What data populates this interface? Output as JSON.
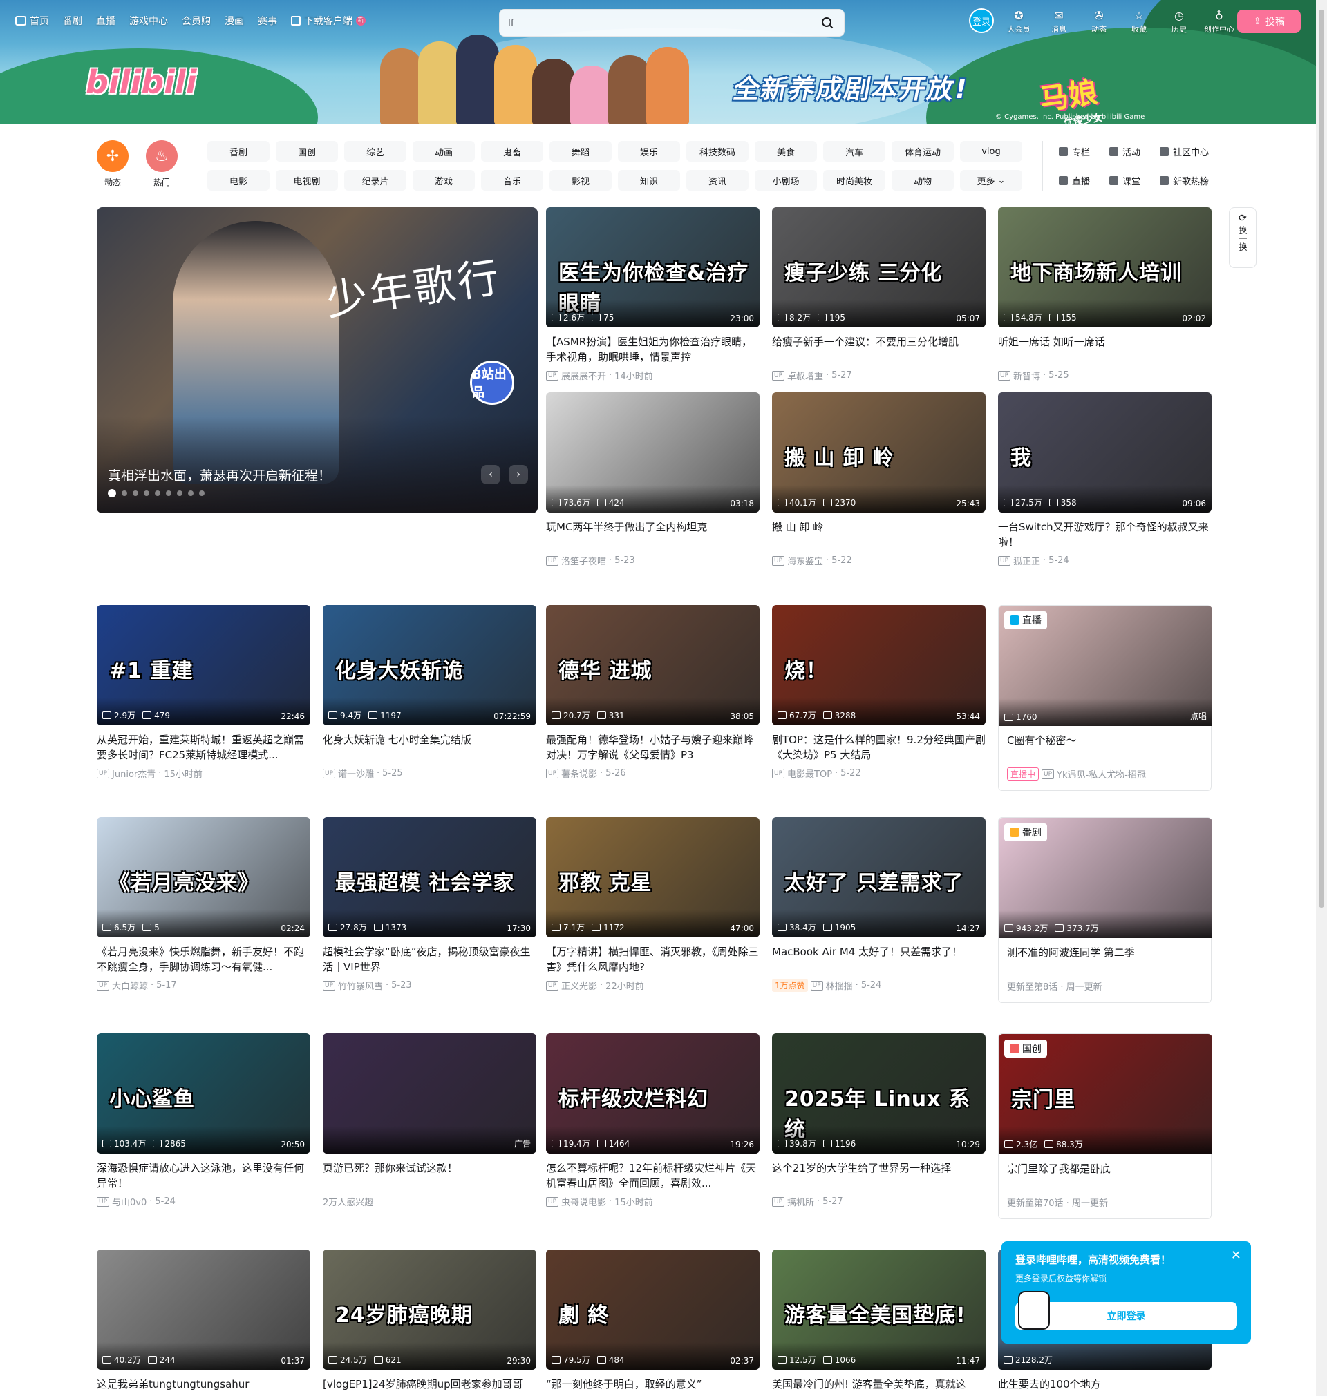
{
  "topnav": {
    "items": [
      {
        "label": "首页",
        "icon": "bilibili-tv-icon"
      },
      {
        "label": "番剧"
      },
      {
        "label": "直播"
      },
      {
        "label": "游戏中心"
      },
      {
        "label": "会员购"
      },
      {
        "label": "漫画"
      },
      {
        "label": "赛事"
      },
      {
        "label": "下载客户端",
        "icon": "download-icon",
        "badge": "新"
      }
    ],
    "search_value": "lf",
    "login_label": "登录",
    "right_items": [
      {
        "label": "大会员",
        "icon": "vip-icon"
      },
      {
        "label": "消息",
        "icon": "message-icon"
      },
      {
        "label": "动态",
        "icon": "dynamic-icon"
      },
      {
        "label": "收藏",
        "icon": "star-icon"
      },
      {
        "label": "历史",
        "icon": "clock-icon"
      },
      {
        "label": "创作中心",
        "icon": "bulb-icon"
      }
    ],
    "upload_label": "投稿"
  },
  "banner": {
    "logo": "bilibili",
    "promo_text": "全新养成剧本开放!",
    "game_logo": "马娘",
    "game_sub": "优俊少女",
    "copyright": "© Cygames, Inc. Published by bilibili Game"
  },
  "channels": {
    "icons": [
      {
        "label": "动态",
        "icon": "pinwheel-icon"
      },
      {
        "label": "热门",
        "icon": "flame-icon"
      }
    ],
    "buttons": [
      "番剧",
      "国创",
      "综艺",
      "动画",
      "鬼畜",
      "舞蹈",
      "娱乐",
      "科技数码",
      "美食",
      "汽车",
      "体育运动",
      "vlog",
      "电影",
      "电视剧",
      "纪录片",
      "游戏",
      "音乐",
      "影视",
      "知识",
      "资讯",
      "小剧场",
      "时尚美妆",
      "动物",
      "更多"
    ],
    "links": [
      "专栏",
      "活动",
      "社区中心",
      "直播",
      "课堂",
      "新歌热榜"
    ]
  },
  "carousel": {
    "title": "真相浮出水面，萧瑟再次开启新征程！",
    "calligraphy": "少年歌行",
    "badge": "B站出品",
    "dot_count": 9,
    "active_dot": 0
  },
  "refresh_label": "换一换",
  "cards": [
    {
      "views": "2.6万",
      "comments": "75",
      "duration": "23:00",
      "title": "【ASMR扮演】医生姐姐为你检查治疗眼睛，手术视角，助眠哄睡，情景声控",
      "up": "展展展不开",
      "date": "14小时前",
      "caption": "医生为你检查&治疗眼睛",
      "color": "#3d5a6b"
    },
    {
      "views": "8.2万",
      "comments": "195",
      "duration": "05:07",
      "title": "给瘦子新手一个建议：不要用三分化增肌",
      "up": "卓叔增重",
      "date": "5-27",
      "caption": "瘦子少练 三分化",
      "color": "#5a5a5c"
    },
    {
      "views": "54.8万",
      "comments": "155",
      "duration": "02:02",
      "title": "听姐一席话 如听一席话",
      "up": "新智博",
      "date": "5-25",
      "caption": "地下商场新人培训",
      "color": "#6a7a5a"
    },
    {
      "views": "73.6万",
      "comments": "424",
      "duration": "03:18",
      "title": "玩MC两年半终于做出了全内构坦克",
      "up": "洛笙子夜喵",
      "date": "5-23",
      "caption": "",
      "color": "#d8d8d8"
    },
    {
      "views": "40.1万",
      "comments": "2370",
      "duration": "25:43",
      "title": "搬 山 卸 岭",
      "up": "海东鉴宝",
      "date": "5-22",
      "caption": "搬 山 卸 岭",
      "color": "#8a6a4a"
    },
    {
      "views": "27.5万",
      "comments": "358",
      "duration": "09:06",
      "title": "一台Switch又开游戏厅？那个奇怪的叔叔又来啦！",
      "up": "狐正正",
      "date": "5-24",
      "caption": "我",
      "color": "#4a4a5a"
    },
    {
      "views": "2.9万",
      "comments": "479",
      "duration": "22:46",
      "title": "从英冠开始，重建莱斯特城！重返英超之巅需要多长时间？FC25莱斯特城经理模式...",
      "up": "Junior杰青",
      "date": "15小时前",
      "caption": "#1 重建",
      "color": "#1d3f8a"
    },
    {
      "views": "9.4万",
      "comments": "1197",
      "duration": "07:22:59",
      "title": "化身大妖斩诡 七小时全集完结版",
      "up": "诺一沙雕",
      "date": "5-25",
      "caption": "化身大妖斩诡",
      "color": "#2a5a8a"
    },
    {
      "views": "20.7万",
      "comments": "331",
      "duration": "38:05",
      "title": "最强配角！德华登场！小姑子与嫂子迎来巅峰对决！万字解说《父母爱情》P3",
      "up": "薯条说影",
      "date": "5-26",
      "caption": "德华 进城",
      "color": "#6a4a3a"
    },
    {
      "views": "67.7万",
      "comments": "3288",
      "duration": "53:44",
      "title": "剧TOP：这是什么样的国家！9.2分经典国产剧《大染坊》P5 大结局",
      "up": "电影最TOP",
      "date": "5-22",
      "caption": "烧！",
      "color": "#7a2a1a"
    },
    {
      "views": "1760",
      "comments": "",
      "duration": "点唱",
      "title": "C圈有个秘密～",
      "up": "Yk遇见-私人尤物-招冠",
      "date": "",
      "caption": "",
      "color": "#d8b8b8",
      "tag": "直播",
      "live": "直播中"
    },
    {
      "views": "6.5万",
      "comments": "5",
      "duration": "02:24",
      "title": "《若月亮没来》快乐燃脂舞，新手友好！不跑不跳瘦全身，手脚协调练习～有氧健...",
      "up": "大白鲸鲸",
      "date": "5-17",
      "caption": "《若月亮没来》",
      "color": "#c8d8e8"
    },
    {
      "views": "27.8万",
      "comments": "1373",
      "duration": "17:30",
      "title": "超模社会学家“卧底”夜店，揭秘顶级富豪夜生活｜VIP世界",
      "up": "竹竹暴风雪",
      "date": "5-23",
      "caption": "最强超模 社会学家",
      "color": "#2a3a5a"
    },
    {
      "views": "7.1万",
      "comments": "1172",
      "duration": "47:00",
      "title": "【万字精讲】横扫悍匪、消灭邪教，《周处除三害》凭什么风靡内地?",
      "up": "正义光影",
      "date": "22小时前",
      "caption": "邪教 克星",
      "color": "#8a6a3a"
    },
    {
      "views": "38.4万",
      "comments": "1905",
      "duration": "14:27",
      "title": "MacBook Air M4 太好了！只差需求了！",
      "up": "林揺揺",
      "date": "5-24",
      "caption": "太好了 只差需求了",
      "color": "#4a5a6a",
      "hot": "1万点赞"
    },
    {
      "views": "943.2万",
      "comments": "373.7万",
      "duration": "",
      "title": "测不准的阿波连同学 第二季",
      "up": "",
      "date": "更新至第8话 · 周一更新",
      "caption": "",
      "color": "#e8c8d8",
      "tag": "番剧"
    },
    {
      "views": "103.4万",
      "comments": "2865",
      "duration": "20:50",
      "title": "深海恐惧症请放心进入这泳池，这里没有任何异常！",
      "up": "与山0v0",
      "date": "5-24",
      "caption": "小心鲨鱼",
      "color": "#1a5a6a"
    },
    {
      "views": "",
      "comments": "",
      "duration": "广告",
      "title": "页游已死？那你来试试这款！",
      "up": "",
      "date": "2万人感兴趣",
      "caption": "",
      "color": "#3a2a4a"
    },
    {
      "views": "19.4万",
      "comments": "1464",
      "duration": "19:26",
      "title": "怎么不算标杆呢？12年前标杆级灾烂神片《天机富春山居图》全面回顾，喜剧效...",
      "up": "虫哥说电影",
      "date": "15小时前",
      "caption": "标杆级灾烂科幻",
      "color": "#5a2a3a"
    },
    {
      "views": "39.8万",
      "comments": "1196",
      "duration": "10:29",
      "title": "这个21岁的大学生给了世界另一种选择",
      "up": "搞机所",
      "date": "5-27",
      "caption": "2025年 Linux 系统",
      "color": "#2a3a2a"
    },
    {
      "views": "2.3亿",
      "comments": "88.3万",
      "duration": "",
      "title": "宗门里除了我都是卧底",
      "up": "",
      "date": "更新至第70话 · 周一更新",
      "caption": "宗门里",
      "color": "#8a1a1a",
      "tag": "国创"
    },
    {
      "views": "40.2万",
      "comments": "244",
      "duration": "01:37",
      "title": "这是我弟弟tungtungtungsahur",
      "up": "",
      "date": "",
      "caption": "",
      "color": "#8a8a8a"
    },
    {
      "views": "24.5万",
      "comments": "621",
      "duration": "29:30",
      "title": "[vlogEP1]24岁肺癌晚期up回老家参加哥哥",
      "up": "",
      "date": "",
      "caption": "24岁肺癌晚期",
      "color": "#6a6a5a"
    },
    {
      "views": "79.5万",
      "comments": "484",
      "duration": "02:37",
      "title": "“那一刻他终于明白，取经的意义”",
      "up": "",
      "date": "",
      "caption": "劇 終",
      "color": "#5a3a2a"
    },
    {
      "views": "12.5万",
      "comments": "1066",
      "duration": "11:47",
      "title": "美国最冷门的州! 游客量全美垫底，真就这",
      "up": "",
      "date": "",
      "caption": "游客量全美国垫底!",
      "color": "#5a7a4a"
    },
    {
      "views": "2128.2万",
      "comments": "",
      "duration": "",
      "title": "此生要去的100个地方",
      "up": "",
      "date": "",
      "caption": "",
      "color": "#4a6a8a"
    }
  ],
  "login_popup": {
    "title": "登录哔哩哔哩，高清视频免费看！",
    "subtitle": "更多登录后权益等你解锁",
    "button": "立即登录"
  }
}
